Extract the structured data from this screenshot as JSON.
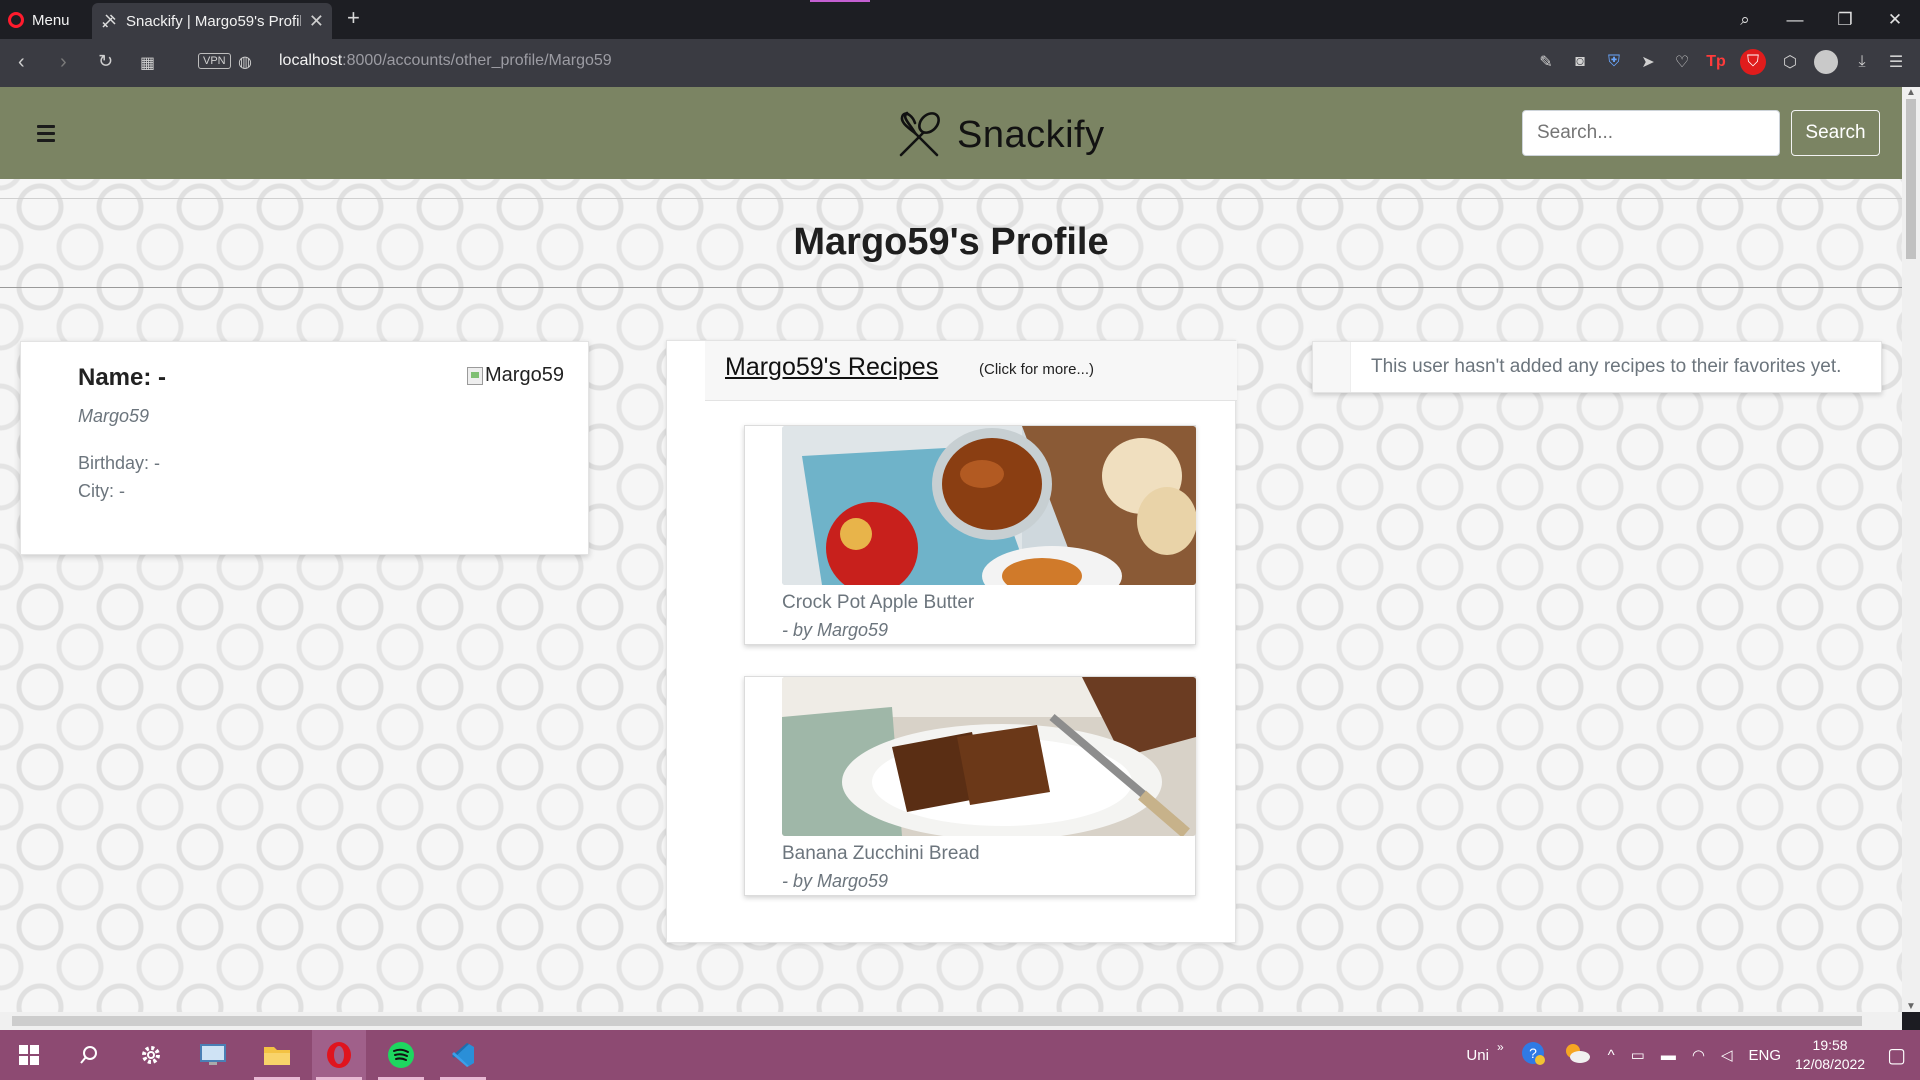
{
  "browser": {
    "menu_label": "Menu",
    "tab_title": "Snackify | Margo59's Profile",
    "new_tab_symbol": "+",
    "url_host": "localhost",
    "url_path": ":8000/accounts/other_profile/Margo59",
    "vpn_label": "VPN"
  },
  "site": {
    "brand_name": "Snackify",
    "search_placeholder": "Search...",
    "search_button": "Search",
    "nav_color": "#7b8463"
  },
  "page": {
    "title": "Margo59's Profile"
  },
  "profile": {
    "name_line": "Name: -",
    "username": "Margo59",
    "birthday_line": "Birthday: -",
    "city_line": "City: -",
    "image_alt": "Margo59"
  },
  "recipes": {
    "heading": "Margo59's Recipes",
    "more_hint": "(Click for more...)",
    "items": [
      {
        "name": "Crock Pot Apple Butter",
        "author": "- by Margo59"
      },
      {
        "name": "Banana Zucchini Bread",
        "author": "- by Margo59"
      }
    ]
  },
  "favorites": {
    "empty_message": "This user hasn't added any recipes to their favorites yet."
  },
  "taskbar": {
    "tray_text": "Uni",
    "language": "ENG",
    "time": "19:58",
    "date": "12/08/2022",
    "bg_color": "#8d4a72"
  }
}
